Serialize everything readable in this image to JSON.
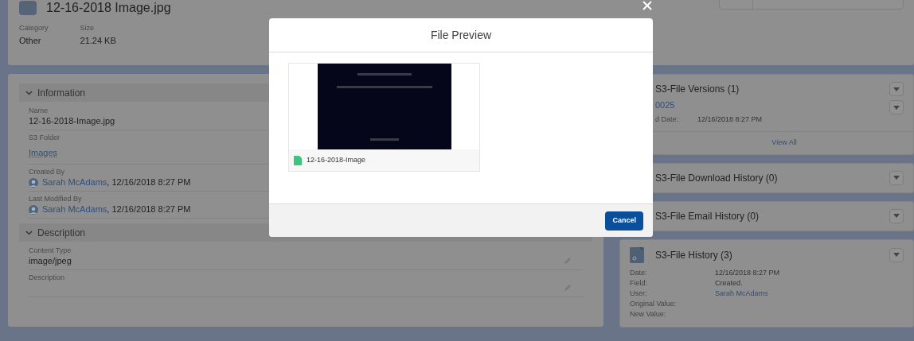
{
  "header": {
    "title": "12-16-2018 Image.jpg",
    "fields": [
      {
        "label": "Category",
        "value": "Other"
      },
      {
        "label": "Size",
        "value": "21.24 KB"
      }
    ]
  },
  "sections": [
    {
      "title": "Information",
      "expanded": true,
      "fields": [
        {
          "label": "Name",
          "kind": "text",
          "value": "12-16-2018-Image.jpg"
        },
        {
          "label": "S3 Folder",
          "kind": "link",
          "value": "Images"
        },
        {
          "label": "Created By",
          "kind": "user",
          "value": "Sarah McAdams",
          "date": ", 12/16/2018 8:27 PM"
        },
        {
          "label": "Last Modified By",
          "kind": "user",
          "value": "Sarah McAdams",
          "date": ", 12/16/2018 8:27 PM"
        }
      ]
    },
    {
      "title": "Description",
      "expanded": true,
      "fields": [
        {
          "label": "Content Type",
          "kind": "editable",
          "value": "image/jpeg"
        },
        {
          "label": "Description",
          "kind": "editable"
        }
      ]
    }
  ],
  "related": [
    {
      "title": "S3-File Versions (1)",
      "record": "0025",
      "rows": [
        {
          "label": "d Date:",
          "value": "12/16/2018 8:27 PM"
        }
      ],
      "view_all": "View All"
    },
    {
      "title": "S3-File Download History (0)"
    },
    {
      "title": "S3-File Email History (0)"
    },
    {
      "title": "S3-File History (3)",
      "icon": true,
      "rows": [
        {
          "label": "Date:",
          "value": "12/16/2018 8:27 PM"
        },
        {
          "label": "Field:",
          "value": "Created."
        },
        {
          "label": "User:",
          "value": "Sarah McAdams",
          "link": true
        },
        {
          "label": "Original Value:"
        },
        {
          "label": "New Value:"
        }
      ]
    }
  ],
  "modal": {
    "title": "File Preview",
    "file_name": "12-16-2018-Image",
    "cancel": "Cancel"
  }
}
